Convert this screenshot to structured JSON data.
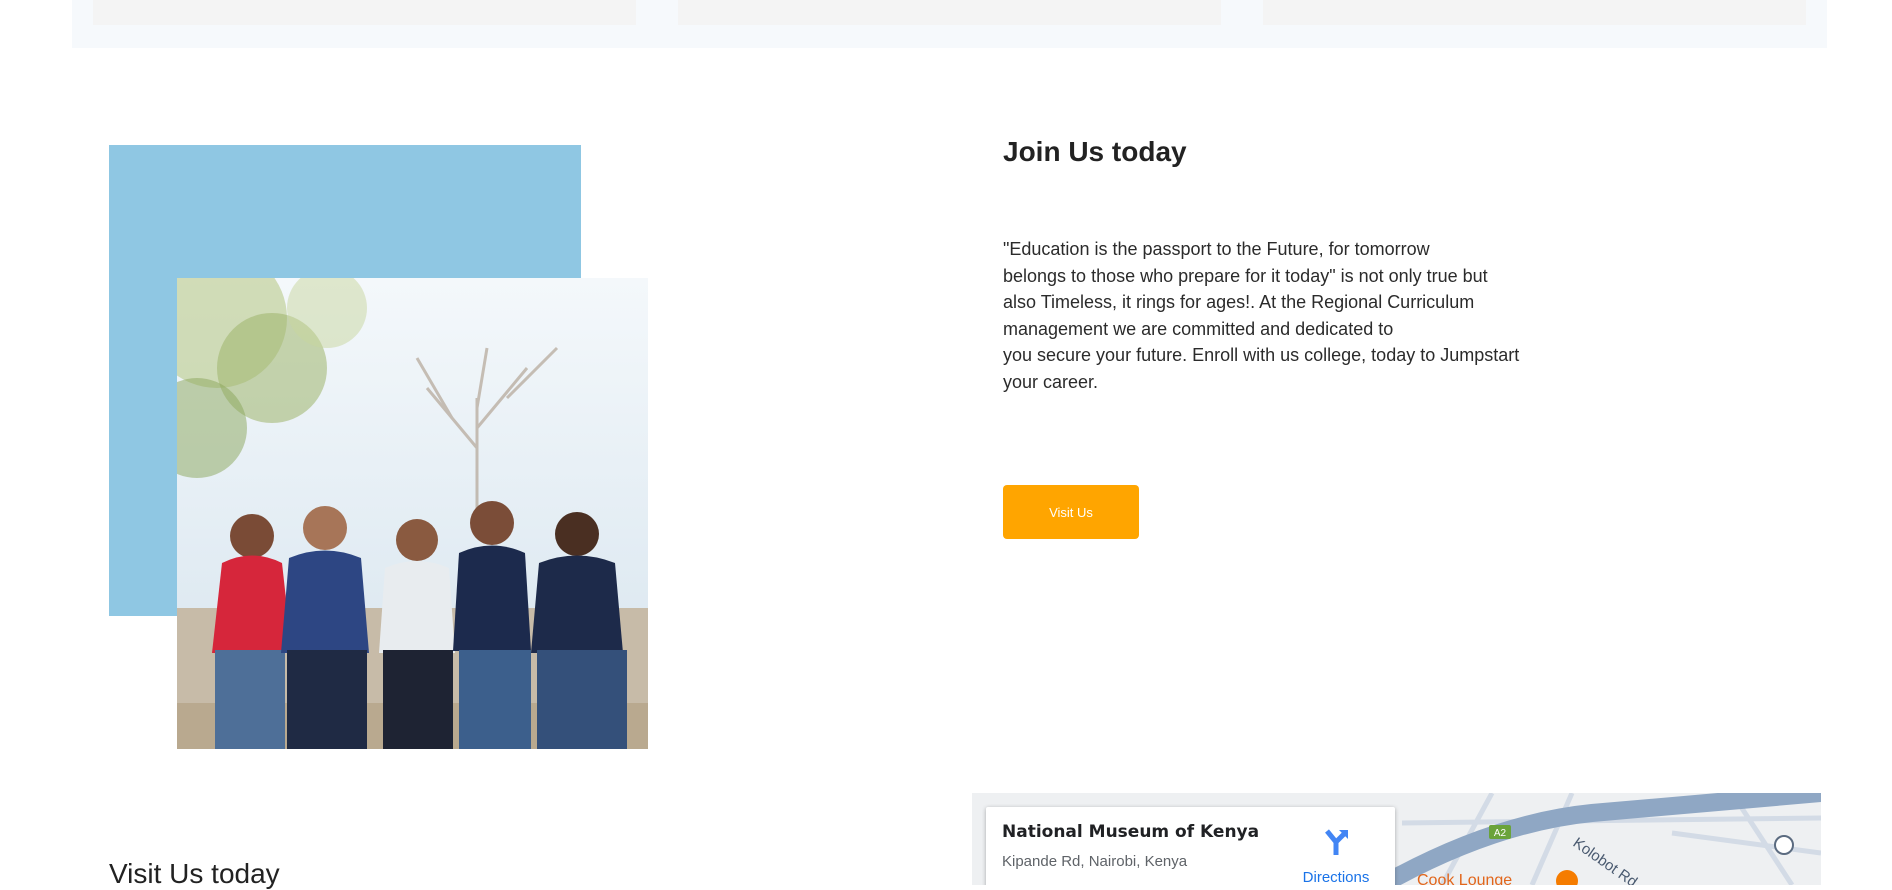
{
  "join": {
    "title": "Join Us today",
    "paragraph_lines": [
      "\"Education is the passport to the Future, for tomorrow",
      "belongs to those who prepare for it today\" is not only true but",
      "also Timeless, it rings for ages!. At the Regional Curriculum",
      "management we are committed and dedicated to",
      "you secure your future. Enroll with us college, today to Jumpstart",
      "your career."
    ],
    "button_label": "Visit Us"
  },
  "visit": {
    "title": "Visit Us today"
  },
  "map": {
    "place_name": "National Museum of Kenya",
    "address": "Kipande Rd, Nairobi, Kenya",
    "directions_label": "Directions",
    "road_labels": [
      "Kolobot Rd",
      "A2"
    ],
    "poi_labels": [
      "Cook Lounge"
    ]
  },
  "colors": {
    "accent_button": "#ffa500",
    "image_backdrop": "#8fc7e3",
    "map_link": "#1a73e8"
  },
  "icons": {
    "directions": "directions-icon",
    "transit": "bus-stop-icon",
    "restaurant": "restaurant-icon"
  }
}
